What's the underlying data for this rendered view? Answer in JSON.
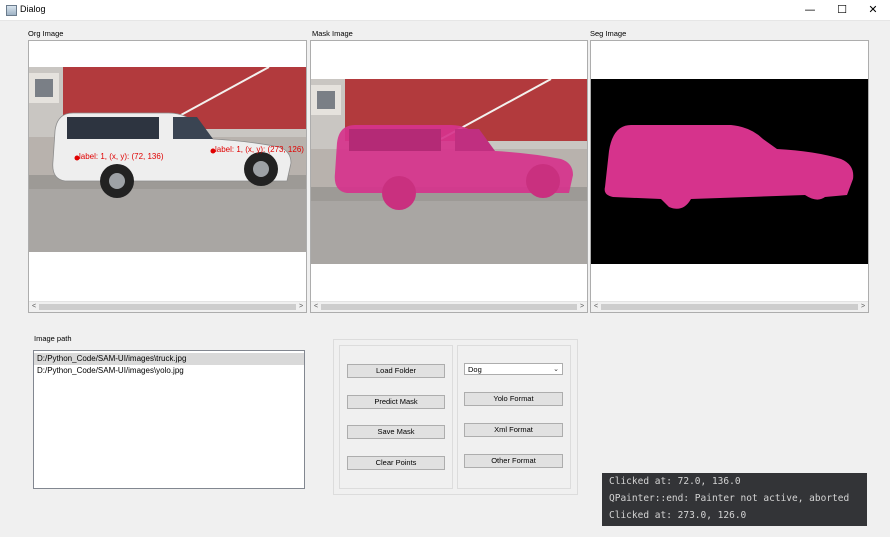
{
  "window": {
    "title": "Dialog",
    "minimize_glyph": "—",
    "maximize_glyph": "☐",
    "close_glyph": "✕"
  },
  "panels": {
    "org": {
      "label": "Org Image"
    },
    "mask": {
      "label": "Mask Image"
    },
    "seg": {
      "label": "Seg Image"
    }
  },
  "points": [
    {
      "text": "label: 1, (x, y): (72, 136)"
    },
    {
      "text": "label: 1, (x, y): (273, 126)"
    }
  ],
  "scrollbar": {
    "left_arrow": "<",
    "right_arrow": ">"
  },
  "image_path": {
    "label": "Image path",
    "items": [
      {
        "text": "D:/Python_Code/SAM-UI/images\\truck.jpg",
        "selected": true
      },
      {
        "text": "D:/Python_Code/SAM-UI/images\\yolo.jpg",
        "selected": false
      }
    ]
  },
  "buttons": {
    "load_folder": "Load Folder",
    "predict_mask": "Predict Mask",
    "save_mask": "Save Mask",
    "clear_points": "Clear Points",
    "yolo_format": "Yolo Format",
    "xml_format": "Xml Format",
    "other_format": "Other Format"
  },
  "class_select": {
    "value": "Dog",
    "caret": "⌄"
  },
  "console": {
    "lines": [
      "Clicked at: 72.0, 136.0",
      "QPainter::end: Painter not active, aborted",
      "Clicked at: 273.0, 126.0"
    ]
  },
  "colors": {
    "mask": "#d6338c",
    "point": "#e00000",
    "console_bg": "#333437"
  }
}
